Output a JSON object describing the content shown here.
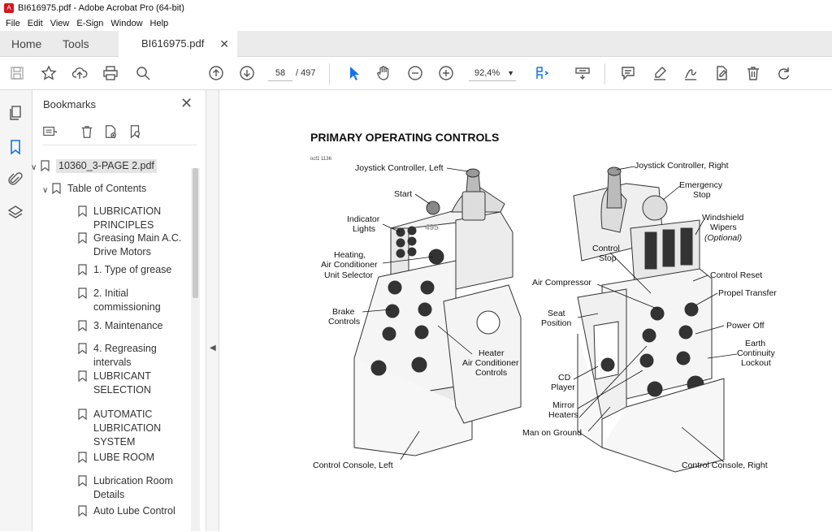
{
  "window": {
    "title": "BI616975.pdf - Adobe Acrobat Pro (64-bit)"
  },
  "menu": [
    "File",
    "Edit",
    "View",
    "E-Sign",
    "Window",
    "Help"
  ],
  "tabs": {
    "home": "Home",
    "tools": "Tools",
    "doc": "BI616975.pdf"
  },
  "toolbar": {
    "page_current": "58",
    "page_total": "/ 497",
    "zoom": "92,4%"
  },
  "bookmarks": {
    "title": "Bookmarks",
    "items": [
      {
        "label": "10360_3-PAGE 2.pdf"
      },
      {
        "label": "Table of Contents"
      },
      {
        "label": "LUBRICATION PRINCIPLES"
      },
      {
        "label": "Greasing Main A.C. Drive Motors"
      },
      {
        "label": "1. Type of grease"
      },
      {
        "label": "2. Initial commissioning"
      },
      {
        "label": "3. Maintenance"
      },
      {
        "label": "4. Regreasing intervals"
      },
      {
        "label": "LUBRICANT SELECTION"
      },
      {
        "label": "AUTOMATIC LUBRICATION SYSTEM"
      },
      {
        "label": "LUBE ROOM"
      },
      {
        "label": "Lubrication Room Details"
      },
      {
        "label": "Auto Lube Control"
      }
    ]
  },
  "document": {
    "heading": "PRIMARY OPERATING CONTROLS",
    "figure_id": "ocf1 1136",
    "labels": {
      "joy_left": "Joystick Controller, Left",
      "start": "Start",
      "indicator1": "Indicator",
      "indicator2": "Lights",
      "heating1": "Heating,",
      "heating2": "Air Conditioner",
      "heating3": "Unit Selector",
      "brake1": "Brake",
      "brake2": "Controls",
      "heater1": "Heater",
      "heater2": "Air Conditioner",
      "heater3": "Controls",
      "console_left": "Control Console, Left",
      "joy_right": "Joystick Controller, Right",
      "estop1": "Emergency",
      "estop2": "Stop",
      "wipers1": "Windshield",
      "wipers2": "Wipers",
      "wipers3": "(Optional)",
      "cstop1": "Control",
      "cstop2": "Stop",
      "creset": "Control Reset",
      "aircomp": "Air Compressor",
      "propel": "Propel Transfer",
      "seat1": "Seat",
      "seat2": "Position",
      "poweroff": "Power Off",
      "earth1": "Earth",
      "earth2": "Continuity",
      "earth3": "Lockout",
      "cd1": "CD",
      "cd2": "Player",
      "mirror1": "Mirror",
      "mirror2": "Heaters",
      "manground": "Man on Ground",
      "console_right": "Control Console, Right"
    }
  }
}
